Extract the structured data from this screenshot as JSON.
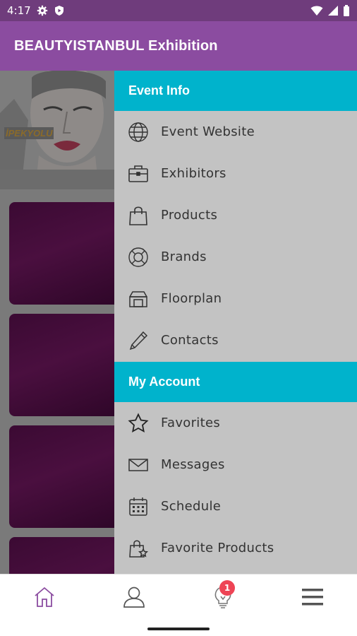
{
  "status_bar": {
    "time": "4:17",
    "icons": [
      "settings-icon",
      "shield-play-icon",
      "wifi-icon",
      "signal-icon",
      "battery-icon"
    ]
  },
  "app_bar": {
    "title": "BEAUTYISTANBUL Exhibition"
  },
  "banner": {
    "brand_text": "İPEKYOLU"
  },
  "drawer": {
    "event_info_header": "Event Info",
    "event_items": [
      {
        "label": "Event Website",
        "icon": "globe-icon"
      },
      {
        "label": "Exhibitors",
        "icon": "briefcase-icon"
      },
      {
        "label": "Products",
        "icon": "shopping-bag-icon"
      },
      {
        "label": "Brands",
        "icon": "lifebuoy-icon"
      },
      {
        "label": "Floorplan",
        "icon": "floorplan-icon"
      },
      {
        "label": "Contacts",
        "icon": "pencil-icon"
      }
    ],
    "my_account_header": "My Account",
    "account_items": [
      {
        "label": "Favorites",
        "icon": "star-icon"
      },
      {
        "label": "Messages",
        "icon": "envelope-icon"
      },
      {
        "label": "Schedule",
        "icon": "calendar-icon"
      },
      {
        "label": "Favorite Products",
        "icon": "favorite-bag-icon"
      }
    ]
  },
  "bottom_nav": {
    "items": [
      {
        "icon": "home-icon"
      },
      {
        "icon": "profile-icon"
      },
      {
        "icon": "lightbulb-icon",
        "badge": "1"
      },
      {
        "icon": "menu-icon"
      }
    ]
  },
  "colors": {
    "status_bar": "#6f3c7c",
    "app_bar": "#8b4ca0",
    "section_header": "#00b3cc",
    "drawer_bg": "#c3c3c3",
    "badge": "#ee4455",
    "home_active": "#8b4ca0"
  }
}
